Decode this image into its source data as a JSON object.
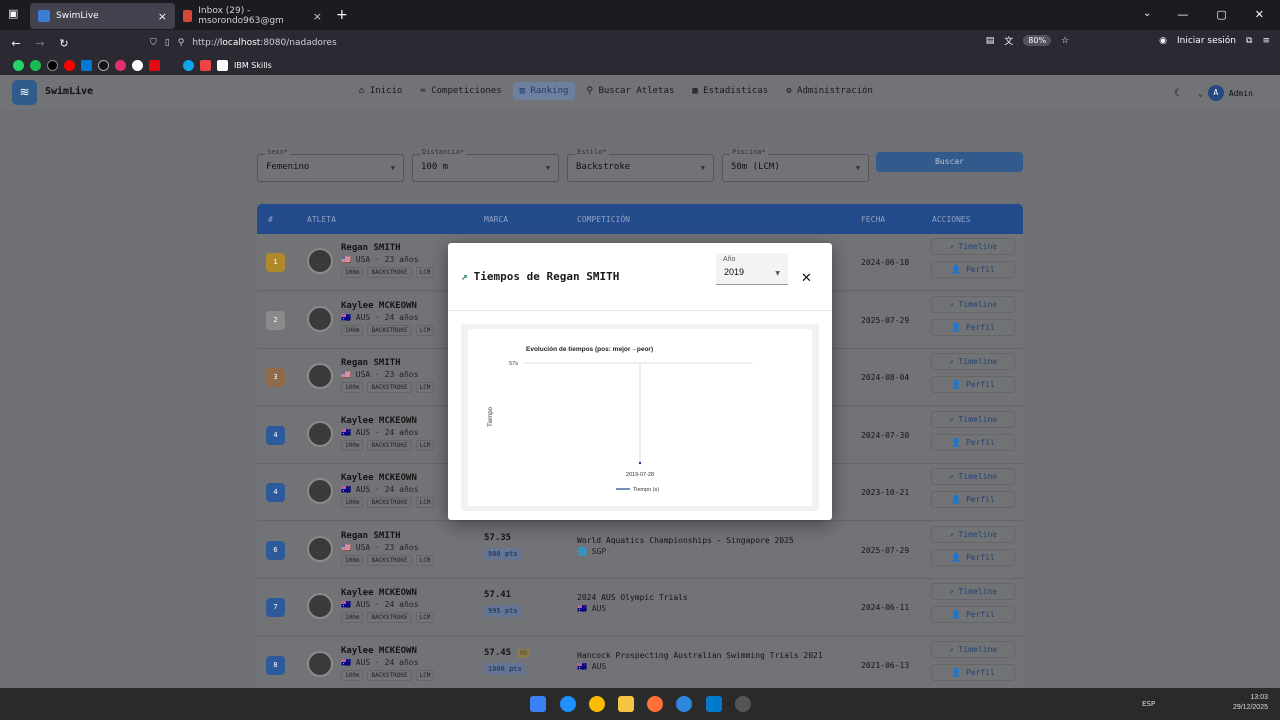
{
  "browser": {
    "tabs": [
      {
        "label": "SwimLive",
        "active": true
      },
      {
        "label": "Inbox (29) - msorondo963@gm",
        "active": false
      }
    ],
    "url_prefix": "http://",
    "url_host": "localhost",
    "url_path": ":8080/nadadores",
    "zoom": "80%",
    "signin_label": "Iniciar sesión",
    "bookmark_label": "IBM Skills"
  },
  "app": {
    "brand": "SwimLive",
    "menu": [
      {
        "label": "Inicio",
        "icon": "home-icon",
        "active": false
      },
      {
        "label": "Competiciones",
        "icon": "pool-icon",
        "active": false
      },
      {
        "label": "Ranking",
        "icon": "bar-chart-icon",
        "active": true
      },
      {
        "label": "Buscar Atletas",
        "icon": "person-search-icon",
        "active": false
      },
      {
        "label": "Estadisticas",
        "icon": "stats-icon",
        "active": false
      },
      {
        "label": "Administración",
        "icon": "admin-icon",
        "active": false
      }
    ],
    "user_initial": "A",
    "user_label": "Admin"
  },
  "filters": {
    "sexo": {
      "label": "Sexo*",
      "value": "Femenino"
    },
    "distancia": {
      "label": "Distancia*",
      "value": "100 m"
    },
    "estilo": {
      "label": "Estilo*",
      "value": "Backstroke"
    },
    "piscina": {
      "label": "Piscina*",
      "value": "50m (LCM)"
    },
    "search_label": "Buscar"
  },
  "table": {
    "headers": {
      "rank": "#",
      "atleta": "ATLETA",
      "marca": "MARCA",
      "competicion": "COMPETICIÓN",
      "fecha": "FECHA",
      "acciones": "ACCIONES"
    },
    "timeline_label": "Timeline",
    "perfil_label": "Perfil",
    "rows": [
      {
        "rank": "1",
        "rank_color": "#b08a2a",
        "name": "Regan SMITH",
        "meta": "🇺🇸 USA · 23 años",
        "tags": [
          "100m",
          "BACKSTROKE",
          "LCM"
        ],
        "mark": "",
        "pts": "",
        "wr": "",
        "comp": "",
        "comp_sub": "",
        "date": "2024-06-18"
      },
      {
        "rank": "2",
        "rank_color": "#8a8a8a",
        "name": "Kaylee MCKEOWN",
        "meta": "🇦🇺 AUS · 24 años",
        "tags": [
          "100m",
          "BACKSTROKE",
          "LCM"
        ],
        "mark": "",
        "pts": "",
        "wr": "",
        "comp": "",
        "comp_sub": "",
        "date": "2025-07-29"
      },
      {
        "rank": "3",
        "rank_color": "#8f6a4a",
        "name": "Regan SMITH",
        "meta": "🇺🇸 USA · 23 años",
        "tags": [
          "100m",
          "BACKSTROKE",
          "LCM"
        ],
        "mark": "",
        "pts": "",
        "wr": "",
        "comp": "",
        "comp_sub": "",
        "date": "2024-08-04"
      },
      {
        "rank": "4",
        "rank_color": "#2c5a9a",
        "name": "Kaylee MCKEOWN",
        "meta": "🇦🇺 AUS · 24 años",
        "tags": [
          "100m",
          "BACKSTROKE",
          "LCM"
        ],
        "mark": "",
        "pts": "",
        "wr": "",
        "comp": "",
        "comp_sub": "",
        "date": "2024-07-30"
      },
      {
        "rank": "4",
        "rank_color": "#2c5a9a",
        "name": "Kaylee MCKEOWN",
        "meta": "🇦🇺 AUS · 24 años",
        "tags": [
          "100m",
          "BACKSTROKE",
          "LCM"
        ],
        "mark": "",
        "pts": "",
        "wr": "",
        "comp": "",
        "comp_sub": "",
        "date": "2023-10-21"
      },
      {
        "rank": "6",
        "rank_color": "#2c5a9a",
        "name": "Regan SMITH",
        "meta": "🇺🇸 USA · 23 años",
        "tags": [
          "100m",
          "BACKSTROKE",
          "LCM"
        ],
        "mark": "57.35",
        "pts": "980 pts",
        "wr": "",
        "comp": "World Aquatics Championships - Singapore 2025",
        "comp_sub": "🌐 SGP",
        "date": "2025-07-29"
      },
      {
        "rank": "7",
        "rank_color": "#2c5a9a",
        "name": "Kaylee MCKEOWN",
        "meta": "🇦🇺 AUS · 24 años",
        "tags": [
          "100m",
          "BACKSTROKE",
          "LCM"
        ],
        "mark": "57.41",
        "pts": "995 pts",
        "wr": "",
        "comp": "2024 AUS Olympic Trials",
        "comp_sub": "🇦🇺 AUS",
        "date": "2024-06-11"
      },
      {
        "rank": "8",
        "rank_color": "#2c5a9a",
        "name": "Kaylee MCKEOWN",
        "meta": "🇦🇺 AUS · 24 años",
        "tags": [
          "100m",
          "BACKSTROKE",
          "LCM"
        ],
        "mark": "57.45",
        "pts": "1006 pts",
        "wr": "RR",
        "comp": "Hancock Prospecting Australian Swimming Trials 2021",
        "comp_sub": "🇦🇺 AUS",
        "date": "2021-06-13"
      }
    ]
  },
  "modal": {
    "title": "Tiempos de Regan SMITH",
    "year_label": "Año",
    "year_value": "2019",
    "close_icon": "close-icon"
  },
  "chart_data": {
    "type": "line",
    "title": "Evolución de tiempos (pos: mejor→peor)",
    "ylabel": "Tiempo",
    "xlabel": "",
    "y_tick_labels": [
      "57s"
    ],
    "x": [
      "2019-07-28"
    ],
    "series": [
      {
        "name": "Tiempo (s)",
        "values": [
          57
        ],
        "color": "#1f3f8a"
      }
    ],
    "grid": true,
    "legend": "bottom"
  },
  "taskbar": {
    "lang": "ESP",
    "time": "13:03",
    "date": "29/12/2025"
  }
}
